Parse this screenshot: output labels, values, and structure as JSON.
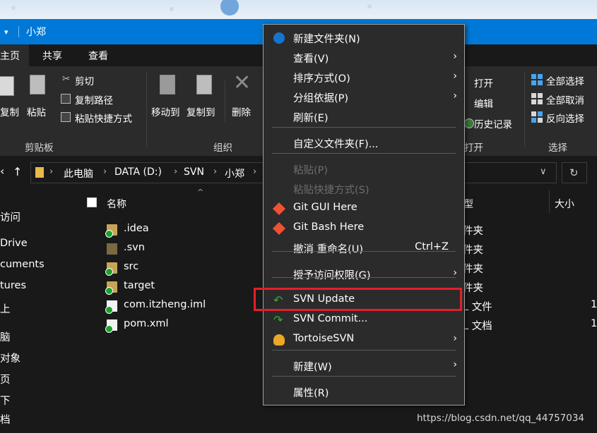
{
  "window": {
    "title": "小郑",
    "qa_arrow": "▾"
  },
  "ribbon_tabs": [
    "主页",
    "共享",
    "查看"
  ],
  "ribbon": {
    "copy": "复制",
    "paste": "粘贴",
    "cut": "剪切",
    "copy_path": "复制路径",
    "paste_shortcut": "粘贴快捷方式",
    "group_clipboard": "剪贴板",
    "move_to": "移动到",
    "copy_to": "复制到",
    "delete": "删除",
    "group_organize": "组织",
    "open": "打开",
    "edit": "编辑",
    "history": "历史记录",
    "group_open": "打开",
    "select_all": "全部选择",
    "select_none": "全部取消",
    "invert": "反向选择",
    "group_select": "选择"
  },
  "address": {
    "crumbs": [
      "此电脑",
      "DATA (D:)",
      "SVN",
      "小郑"
    ],
    "up_arrow": "↑",
    "back_arrow": "‹",
    "dropdown": "∨",
    "refresh": "↻"
  },
  "nav_items": [
    "访问",
    "Drive",
    "cuments",
    "tures",
    "上",
    "脑",
    "对象",
    "页",
    "下",
    "档"
  ],
  "columns": {
    "name": "名称",
    "type": "型",
    "size": "大小"
  },
  "files": [
    {
      "name": ".idea",
      "type": "件夹",
      "size": "",
      "kind": "folder",
      "svn": true
    },
    {
      "name": ".svn",
      "type": "件夹",
      "size": "",
      "kind": "folder",
      "svn": false
    },
    {
      "name": "src",
      "type": "件夹",
      "size": "",
      "kind": "folder",
      "svn": true
    },
    {
      "name": "target",
      "type": "件夹",
      "size": "",
      "kind": "folder",
      "svn": true
    },
    {
      "name": "com.itzheng.iml",
      "type": "L 文件",
      "size": "1",
      "kind": "file",
      "svn": true
    },
    {
      "name": "pom.xml",
      "type": "L 文档",
      "size": "1",
      "kind": "file",
      "svn": true
    }
  ],
  "context_menu": [
    {
      "label": "新建文件夹(N)",
      "icon": "new-folder-icon",
      "shortcut": "",
      "submenu": false,
      "disabled": false
    },
    {
      "label": "查看(V)",
      "icon": "",
      "shortcut": "",
      "submenu": true,
      "disabled": false
    },
    {
      "label": "排序方式(O)",
      "icon": "",
      "shortcut": "",
      "submenu": true,
      "disabled": false
    },
    {
      "label": "分组依据(P)",
      "icon": "",
      "shortcut": "",
      "submenu": true,
      "disabled": false
    },
    {
      "label": "刷新(E)",
      "icon": "",
      "shortcut": "",
      "submenu": false,
      "disabled": false
    },
    {
      "label": "自定义文件夹(F)...",
      "icon": "",
      "shortcut": "",
      "submenu": false,
      "disabled": false
    },
    {
      "label": "粘贴(P)",
      "icon": "",
      "shortcut": "",
      "submenu": false,
      "disabled": true
    },
    {
      "label": "粘贴快捷方式(S)",
      "icon": "",
      "shortcut": "",
      "submenu": false,
      "disabled": true
    },
    {
      "label": "Git GUI Here",
      "icon": "git-gui-icon",
      "shortcut": "",
      "submenu": false,
      "disabled": false
    },
    {
      "label": "Git Bash Here",
      "icon": "git-bash-icon",
      "shortcut": "",
      "submenu": false,
      "disabled": false
    },
    {
      "label": "撤消 重命名(U)",
      "icon": "",
      "shortcut": "Ctrl+Z",
      "submenu": false,
      "disabled": false
    },
    {
      "label": "授予访问权限(G)",
      "icon": "",
      "shortcut": "",
      "submenu": true,
      "disabled": false
    },
    {
      "label": "SVN Update",
      "icon": "svn-update-icon",
      "shortcut": "",
      "submenu": false,
      "disabled": false
    },
    {
      "label": "SVN Commit...",
      "icon": "svn-commit-icon",
      "shortcut": "",
      "submenu": false,
      "disabled": false
    },
    {
      "label": "TortoiseSVN",
      "icon": "tortoisesvn-icon",
      "shortcut": "",
      "submenu": true,
      "disabled": false
    },
    {
      "label": "新建(W)",
      "icon": "",
      "shortcut": "",
      "submenu": true,
      "disabled": false
    },
    {
      "label": "属性(R)",
      "icon": "",
      "shortcut": "",
      "submenu": false,
      "disabled": false
    }
  ],
  "highlight_color": "#e3202a",
  "accent_color": "#0078d7",
  "watermark": "https://blog.csdn.net/qq_44757034"
}
